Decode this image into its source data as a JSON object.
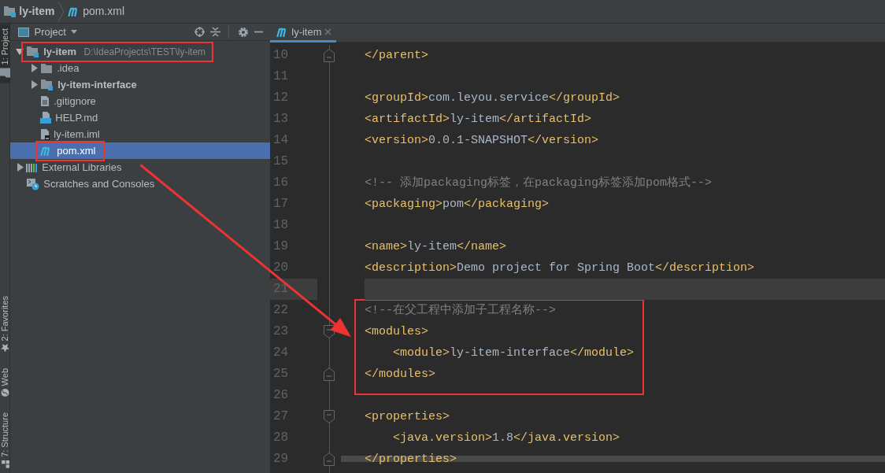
{
  "breadcrumbs": [
    {
      "label": "ly-item",
      "kind": "module",
      "bold": true
    },
    {
      "label": "pom.xml",
      "kind": "maven",
      "bold": false
    }
  ],
  "tool_stripe": [
    {
      "label": "1: Project",
      "kind": "folder",
      "selected": true
    },
    {
      "label": "2: Favorites",
      "kind": "star",
      "selected": false
    },
    {
      "label": "Web",
      "kind": "globe",
      "selected": false
    },
    {
      "label": "7: Structure",
      "kind": "structure",
      "selected": false
    }
  ],
  "project_panel": {
    "title": "Project",
    "tree": [
      {
        "label": "ly-item",
        "hint": "D:\\IdeaProjects\\TEST\\ly-item",
        "kind": "module",
        "bold": true,
        "expanded": true,
        "selected": false,
        "annotated": true,
        "children": [
          {
            "label": ".idea",
            "kind": "folder",
            "bold": false,
            "expanded": false,
            "selected": false,
            "annotated": false
          },
          {
            "label": "ly-item-interface",
            "kind": "module",
            "bold": true,
            "expanded": false,
            "selected": false,
            "annotated": false
          },
          {
            "label": ".gitignore",
            "kind": "file",
            "bold": false,
            "selected": false,
            "annotated": false
          },
          {
            "label": "HELP.md",
            "kind": "markdown",
            "bold": false,
            "selected": false,
            "annotated": false
          },
          {
            "label": "ly-item.iml",
            "kind": "iml",
            "bold": false,
            "selected": false,
            "annotated": false
          },
          {
            "label": "pom.xml",
            "kind": "maven",
            "bold": false,
            "selected": true,
            "annotated": true
          }
        ]
      },
      {
        "label": "External Libraries",
        "kind": "libraries",
        "bold": false,
        "expanded": false,
        "selected": false,
        "annotated": false
      },
      {
        "label": "Scratches and Consoles",
        "kind": "scratches",
        "bold": false,
        "selected": false,
        "annotated": false
      }
    ]
  },
  "editor": {
    "tabs": [
      {
        "label": "ly-item",
        "kind": "maven",
        "selected": true
      }
    ],
    "lines": [
      {
        "number": "10",
        "kind": "foldend",
        "annotated": false,
        "tokens": [
          {
            "kind": "tag",
            "text": "</parent>"
          }
        ]
      },
      {
        "number": "11",
        "kind": "plain",
        "annotated": false
      },
      {
        "number": "12",
        "kind": "plain",
        "annotated": false,
        "tokens": [
          {
            "kind": "tag",
            "text": "<groupId>"
          },
          {
            "kind": "text",
            "text": "com.leyou.service"
          },
          {
            "kind": "tag",
            "text": "</groupId>"
          }
        ]
      },
      {
        "number": "13",
        "kind": "plain",
        "annotated": false,
        "tokens": [
          {
            "kind": "tag",
            "text": "<artifactId>"
          },
          {
            "kind": "text",
            "text": "ly-item"
          },
          {
            "kind": "tag",
            "text": "</artifactId>"
          }
        ]
      },
      {
        "number": "14",
        "kind": "plain",
        "annotated": false,
        "tokens": [
          {
            "kind": "tag",
            "text": "<version>"
          },
          {
            "kind": "text",
            "text": "0.0.1-SNAPSHOT"
          },
          {
            "kind": "tag",
            "text": "</version>"
          }
        ]
      },
      {
        "number": "15",
        "kind": "plain",
        "annotated": false
      },
      {
        "number": "16",
        "kind": "plain",
        "annotated": false,
        "tokens": [
          {
            "kind": "comment",
            "text": "<!-- 添加packaging标签，在packaging标签添加pom格式-->"
          }
        ]
      },
      {
        "number": "17",
        "kind": "plain",
        "annotated": false,
        "tokens": [
          {
            "kind": "tag",
            "text": "<packaging>"
          },
          {
            "kind": "text",
            "text": "pom"
          },
          {
            "kind": "tag",
            "text": "</packaging>"
          }
        ]
      },
      {
        "number": "18",
        "kind": "plain",
        "annotated": false
      },
      {
        "number": "19",
        "kind": "plain",
        "annotated": false,
        "tokens": [
          {
            "kind": "tag",
            "text": "<name>"
          },
          {
            "kind": "text",
            "text": "ly-item"
          },
          {
            "kind": "tag",
            "text": "</name>"
          }
        ]
      },
      {
        "number": "20",
        "kind": "plain",
        "annotated": false,
        "tokens": [
          {
            "kind": "tag",
            "text": "<description>"
          },
          {
            "kind": "text",
            "text": "Demo project for Spring Boot"
          },
          {
            "kind": "tag",
            "text": "</description>"
          }
        ]
      },
      {
        "number": "21",
        "kind": "plain",
        "current": true,
        "annotated": false
      },
      {
        "number": "22",
        "kind": "plain",
        "annotated": true,
        "tokens": [
          {
            "kind": "comment",
            "text": "<!--在父工程中添加子工程名称-->"
          }
        ]
      },
      {
        "number": "23",
        "kind": "foldstart",
        "annotated": true,
        "tokens": [
          {
            "kind": "tag",
            "text": "<modules>"
          }
        ]
      },
      {
        "number": "24",
        "kind": "plain",
        "annotated": true,
        "tokens": [
          {
            "kind": "tag",
            "text": "    <module>"
          },
          {
            "kind": "text",
            "text": "ly-item-interface"
          },
          {
            "kind": "tag",
            "text": "</module>"
          }
        ]
      },
      {
        "number": "25",
        "kind": "foldend",
        "annotated": true,
        "tokens": [
          {
            "kind": "tag",
            "text": "</modules>"
          }
        ]
      },
      {
        "number": "26",
        "kind": "plain",
        "annotated": false
      },
      {
        "number": "27",
        "kind": "foldstart",
        "annotated": false,
        "tokens": [
          {
            "kind": "tag",
            "text": "<properties>"
          }
        ]
      },
      {
        "number": "28",
        "kind": "plain",
        "annotated": false,
        "tokens": [
          {
            "kind": "tag",
            "text": "    <java.version>"
          },
          {
            "kind": "text",
            "text": "1.8"
          },
          {
            "kind": "tag",
            "text": "</java.version>"
          }
        ]
      },
      {
        "number": "29",
        "kind": "foldend",
        "annotated": false,
        "tokens": [
          {
            "kind": "tag",
            "text": "</properties>"
          }
        ]
      }
    ]
  },
  "annotation_arrow": true
}
